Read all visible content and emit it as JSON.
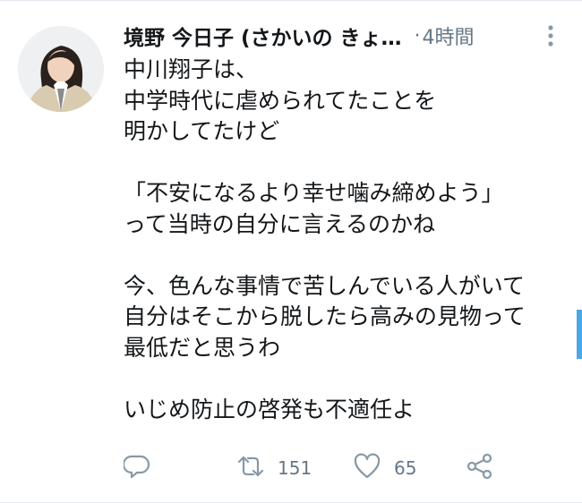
{
  "tweet": {
    "display_name": "境野 今日子 (さかいの きょ…",
    "separator": "·",
    "timestamp": "4時間",
    "body_lines": [
      "中川翔子は、",
      "中学時代に虐められてたことを",
      "明かしてたけど",
      "",
      "「不安になるより幸せ噛み締めよう」",
      "って当時の自分に言えるのかね",
      "",
      "今、色んな事情で苦しんでいる人がいて",
      "自分はそこから脱したら高みの見物って",
      "最低だと思うわ",
      "",
      "いじめ防止の啓発も不適任よ"
    ],
    "actions": {
      "reply_count": "",
      "retweet_count": "151",
      "like_count": "65"
    }
  },
  "icons": {
    "avatar": "profile-photo",
    "more": "more-vertical-icon",
    "reply": "reply-icon",
    "retweet": "retweet-icon",
    "like": "heart-icon",
    "share": "share-icon"
  },
  "colors": {
    "text": "#14171a",
    "secondary": "#657786",
    "icon_gray": "#8899a6",
    "accent": "#4aa8e8"
  }
}
